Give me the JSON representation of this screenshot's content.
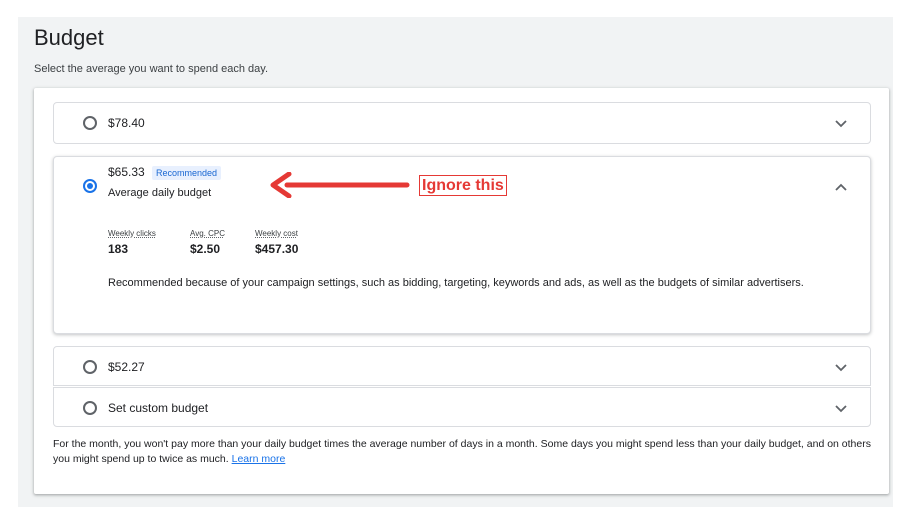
{
  "header": {
    "title": "Budget",
    "subtitle": "Select the average you want to spend each day."
  },
  "options": [
    {
      "amount": "$78.40",
      "selected": false,
      "expanded": false
    },
    {
      "amount": "$65.33",
      "badge": "Recommended",
      "description": "Average daily budget",
      "selected": true,
      "expanded": true,
      "metrics": [
        {
          "label": "Weekly clicks",
          "value": "183"
        },
        {
          "label": "Avg. CPC",
          "value": "$2.50"
        },
        {
          "label": "Weekly cost",
          "value": "$457.30"
        }
      ],
      "recommendation": "Recommended because of your campaign settings, such as bidding, targeting, keywords and ads, as well as the budgets of similar advertisers."
    },
    {
      "amount": "$52.27",
      "selected": false,
      "expanded": false
    },
    {
      "amount": "Set custom budget",
      "selected": false,
      "expanded": false
    }
  ],
  "footer": {
    "note": "For the month, you won't pay more than your daily budget times the average number of days in a month. Some days you might spend less than your daily budget, and on others you might spend up to twice as much.",
    "link_label": "Learn more"
  },
  "annotation": {
    "text": "Ignore this"
  },
  "icons": {
    "chevron_down": "chevron-down-icon",
    "chevron_up": "chevron-up-icon",
    "arrow": "arrow-left-icon"
  },
  "colors": {
    "accent": "#1a73e8",
    "annotation": "#e53935",
    "panel_bg": "#f1f3f4"
  }
}
